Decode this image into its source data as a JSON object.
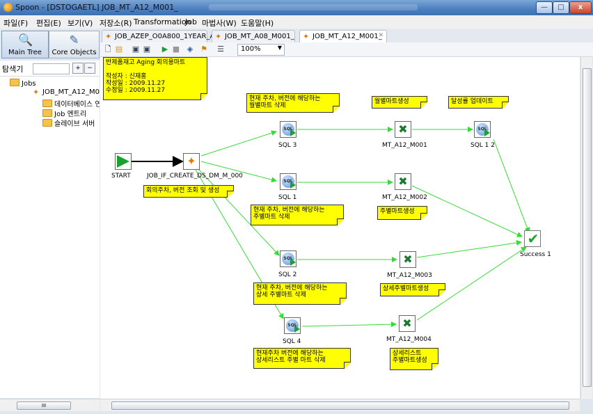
{
  "window": {
    "title": "Spoon - [DSTOGAETL] JOB_MT_A12_M001_",
    "controls": [
      "—",
      "□",
      "x"
    ]
  },
  "menu": [
    "파일(F)",
    "편집(E)",
    "보기(V)",
    "저장소(R)",
    "Transformation",
    "Job",
    "마법사(W)",
    "도움말(H)"
  ],
  "left_panel": {
    "main_tree_label": "Main Tree",
    "core_objects_label": "Core Objects",
    "search_label": "탐색기",
    "tree": {
      "root": "Jobs",
      "job": "JOB_MT_A12_M00",
      "children": [
        "데이터베이스 연",
        "Job 엔트리",
        "슬레이브 서버"
      ]
    },
    "hscroll_label": "III"
  },
  "tabs": [
    {
      "label": "JOB_AZEP_O0A800_1YEAR_ALL",
      "active": false
    },
    {
      "label": "JOB_MT_A08_M001_",
      "active": false
    },
    {
      "label": "JOB_MT_A12_M001_",
      "active": true
    }
  ],
  "toolbar": {
    "zoom": "100%"
  },
  "canvas": {
    "notes": {
      "header": "반제품재고 Aging 회의용마트\n\n작성자 : 신재홍\n작성일 : 2009.11.27\n수정일 : 2009.11.27",
      "sql3_note": "현재 주차, 버전에 해당하는\n월별마트 삭제",
      "monthly_note": "월별마트생성",
      "rate_note": "달성률 업데이트",
      "select_note": "회의주차, 버전 조회 및 생성",
      "sql1_note": "현재 주차, 버전에 해당하는\n주별마트 삭제",
      "weekly_note": "주별마트생성",
      "sql2_note": "현재 주차, 버전에 해당하는\n상세 주별마트 삭제",
      "detail_weekly_note": "상세주별마트생성",
      "sql4_note": "현재주차 버전에 해당하는\n상세리스트 주별 마트 삭제",
      "detail_list_note": "상세리스트\n주별마트생성"
    },
    "steps": {
      "start": "START",
      "job": "JOB_IF_CREATE_DS_DM_M_000",
      "sql3": "SQL 3",
      "sql1": "SQL 1",
      "sql2": "SQL 2",
      "sql4": "SQL 4",
      "sql12": "SQL 1 2",
      "mt1": "MT_A12_M001",
      "mt2": "MT_A12_M002",
      "mt3": "MT_A12_M003",
      "mt4": "MT_A12_M004",
      "success": "Success 1"
    },
    "sql_icon_text": "SQL",
    "hop_color": "#33dd33",
    "note_color": "#ffff00"
  }
}
